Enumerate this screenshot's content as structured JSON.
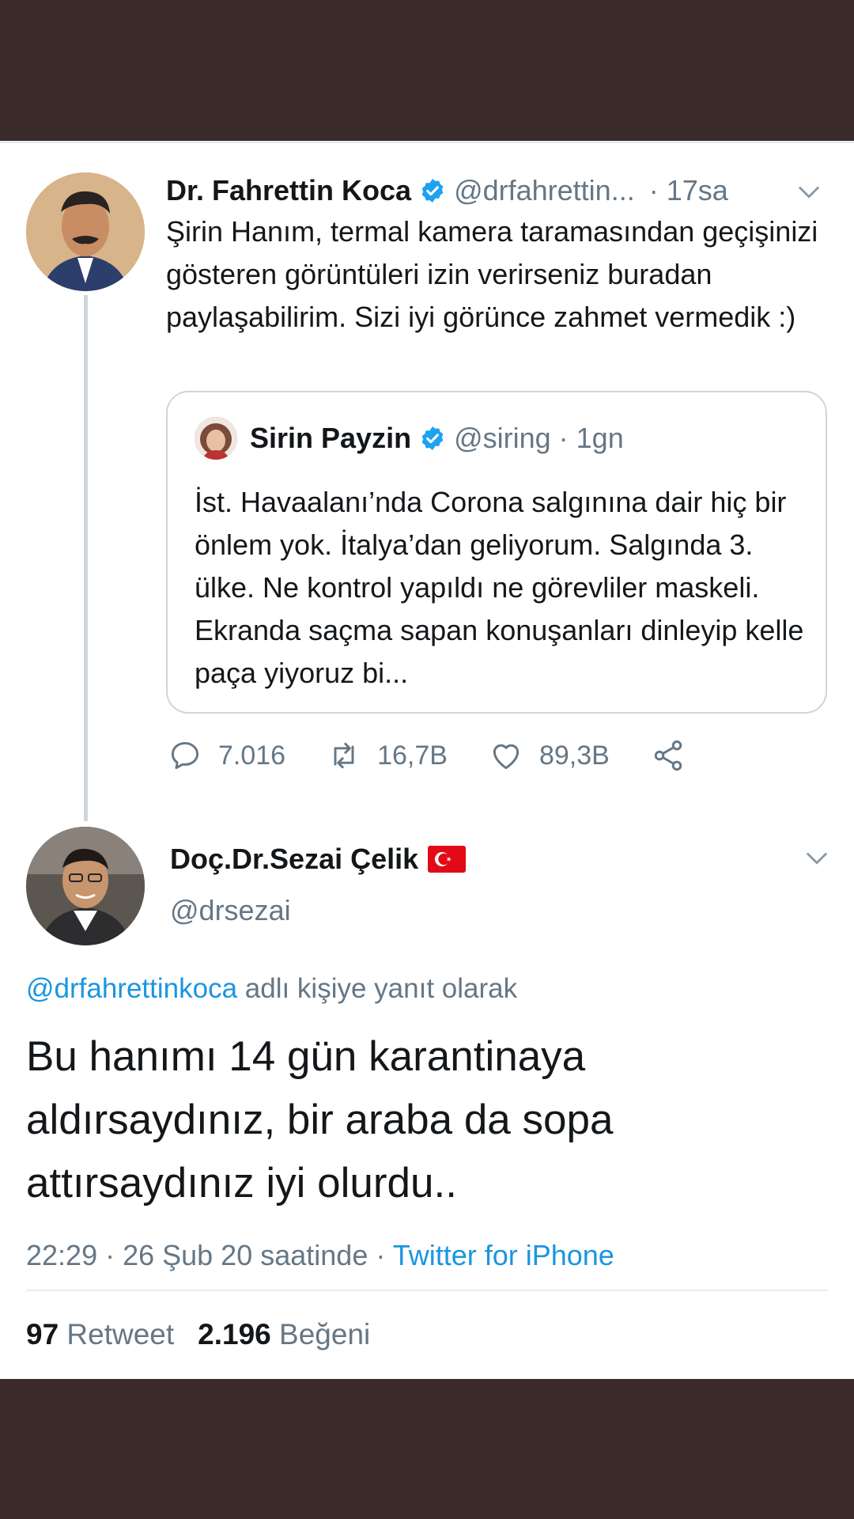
{
  "colors": {
    "band": "#3b2a2a",
    "text": "#14171a",
    "muted": "#657786",
    "link": "#1b95e0",
    "verified": "#1da1f2",
    "border": "#ccd6dd"
  },
  "tweet1": {
    "author_name": "Dr. Fahrettin Koca",
    "handle": "@drfahrettin...",
    "time": "· 17sa",
    "text": "Şirin Hanım, termal kamera taramasından geçişinizi gösteren görüntüleri izin verirseniz buradan paylaşabilirim. Sizi iyi görünce zahmet vermedik :)",
    "quote": {
      "author_name": "Sirin Payzin",
      "handle": "@siring",
      "time": "· 1gn",
      "text": "İst. Havaalanı’nda Corona salgınına dair hiç bir önlem yok. İtalya’dan geliyorum. Salgında 3. ülke. Ne kontrol yapıldı ne görevliler maskeli. Ekranda saçma sapan konuşanları dinleyip kelle paça yiyoruz bi..."
    },
    "actions": {
      "replies": "7.016",
      "retweets": "16,7B",
      "likes": "89,3B"
    }
  },
  "tweet2": {
    "author_name": "Doç.Dr.Sezai Çelik",
    "handle": "@drsezai",
    "reply_to_handle": "@drfahrettinkoca",
    "reply_to_suffix": " adlı kişiye yanıt olarak",
    "text": "Bu hanımı 14 gün karantinaya aldırsaydınız, bir araba da sopa attırsaydınız iyi olurdu..",
    "timestamp": "22:29 · 26 Şub 20 saatinde · ",
    "source": "Twitter for iPhone",
    "retweet_count": "97",
    "retweet_label": " Retweet",
    "like_count": "2.196",
    "like_label": " Beğeni"
  },
  "icons": [
    "verified-badge-icon",
    "chevron-down-icon",
    "reply-icon",
    "retweet-icon",
    "like-icon",
    "share-icon",
    "turkey-flag-icon"
  ]
}
